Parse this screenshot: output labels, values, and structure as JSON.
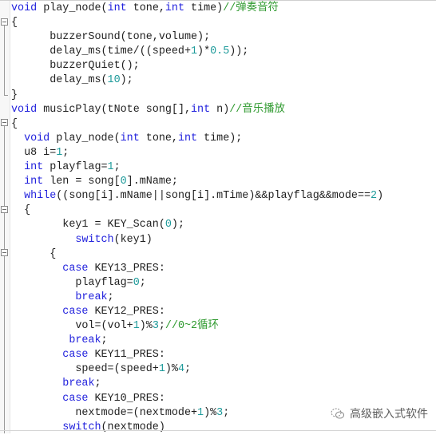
{
  "editor": {
    "lines": [
      {
        "tokens": [
          {
            "t": "void",
            "c": "kw"
          },
          {
            "t": " play_node("
          },
          {
            "t": "int",
            "c": "kw"
          },
          {
            "t": " tone,"
          },
          {
            "t": "int",
            "c": "kw"
          },
          {
            "t": " time)"
          },
          {
            "t": "//弹奏音符",
            "c": "cm"
          }
        ]
      },
      {
        "tokens": [
          {
            "t": "{"
          }
        ]
      },
      {
        "tokens": [
          {
            "t": "      buzzerSound(tone,volume);"
          }
        ]
      },
      {
        "tokens": [
          {
            "t": "      delay_ms(time/((speed+"
          },
          {
            "t": "1",
            "c": "num"
          },
          {
            "t": ")*"
          },
          {
            "t": "0.5",
            "c": "num"
          },
          {
            "t": "));"
          }
        ]
      },
      {
        "tokens": [
          {
            "t": "      buzzerQuiet();"
          }
        ]
      },
      {
        "tokens": [
          {
            "t": "      delay_ms("
          },
          {
            "t": "10",
            "c": "num"
          },
          {
            "t": ");"
          }
        ]
      },
      {
        "tokens": [
          {
            "t": "}"
          }
        ]
      },
      {
        "tokens": [
          {
            "t": "void",
            "c": "kw"
          },
          {
            "t": " musicPlay(tNote song[],"
          },
          {
            "t": "int",
            "c": "kw"
          },
          {
            "t": " n)"
          },
          {
            "t": "//音乐播放",
            "c": "cm"
          }
        ]
      },
      {
        "tokens": [
          {
            "t": "{"
          }
        ]
      },
      {
        "tokens": [
          {
            "t": "  "
          },
          {
            "t": "void",
            "c": "kw"
          },
          {
            "t": " play_node("
          },
          {
            "t": "int",
            "c": "kw"
          },
          {
            "t": " tone,"
          },
          {
            "t": "int",
            "c": "kw"
          },
          {
            "t": " time);"
          }
        ]
      },
      {
        "tokens": [
          {
            "t": "  u8 i="
          },
          {
            "t": "1",
            "c": "num"
          },
          {
            "t": ";"
          }
        ]
      },
      {
        "tokens": [
          {
            "t": "  "
          },
          {
            "t": "int",
            "c": "kw"
          },
          {
            "t": " playflag="
          },
          {
            "t": "1",
            "c": "num"
          },
          {
            "t": ";"
          }
        ]
      },
      {
        "tokens": [
          {
            "t": "  "
          },
          {
            "t": "int",
            "c": "kw"
          },
          {
            "t": " len = song["
          },
          {
            "t": "0",
            "c": "num"
          },
          {
            "t": "].mName;"
          }
        ]
      },
      {
        "tokens": [
          {
            "t": "  "
          },
          {
            "t": "while",
            "c": "kw"
          },
          {
            "t": "((song[i].mName||song[i].mTime)&&playflag&&mode=="
          },
          {
            "t": "2",
            "c": "num"
          },
          {
            "t": ")"
          }
        ]
      },
      {
        "tokens": [
          {
            "t": "  {"
          }
        ]
      },
      {
        "tokens": [
          {
            "t": "        key1 = KEY_Scan("
          },
          {
            "t": "0",
            "c": "num"
          },
          {
            "t": ");"
          }
        ]
      },
      {
        "tokens": [
          {
            "t": "          "
          },
          {
            "t": "switch",
            "c": "kw"
          },
          {
            "t": "(key1)"
          }
        ]
      },
      {
        "tokens": [
          {
            "t": "      {"
          }
        ]
      },
      {
        "tokens": [
          {
            "t": "        "
          },
          {
            "t": "case",
            "c": "kw"
          },
          {
            "t": " KEY13_PRES:"
          }
        ]
      },
      {
        "tokens": [
          {
            "t": "          playflag="
          },
          {
            "t": "0",
            "c": "num"
          },
          {
            "t": ";"
          }
        ]
      },
      {
        "tokens": [
          {
            "t": "          "
          },
          {
            "t": "break",
            "c": "kw"
          },
          {
            "t": ";"
          }
        ]
      },
      {
        "tokens": [
          {
            "t": "        "
          },
          {
            "t": "case",
            "c": "kw"
          },
          {
            "t": " KEY12_PRES:"
          }
        ]
      },
      {
        "tokens": [
          {
            "t": "          vol=(vol+"
          },
          {
            "t": "1",
            "c": "num"
          },
          {
            "t": ")%"
          },
          {
            "t": "3",
            "c": "num"
          },
          {
            "t": ";"
          },
          {
            "t": "//0~2循环",
            "c": "cm"
          }
        ]
      },
      {
        "tokens": [
          {
            "t": "         "
          },
          {
            "t": "break",
            "c": "kw"
          },
          {
            "t": ";"
          }
        ]
      },
      {
        "tokens": [
          {
            "t": "        "
          },
          {
            "t": "case",
            "c": "kw"
          },
          {
            "t": " KEY11_PRES:"
          }
        ]
      },
      {
        "tokens": [
          {
            "t": "          speed=(speed+"
          },
          {
            "t": "1",
            "c": "num"
          },
          {
            "t": ")%"
          },
          {
            "t": "4",
            "c": "num"
          },
          {
            "t": ";"
          }
        ]
      },
      {
        "tokens": [
          {
            "t": "        "
          },
          {
            "t": "break",
            "c": "kw"
          },
          {
            "t": ";"
          }
        ]
      },
      {
        "tokens": [
          {
            "t": "        "
          },
          {
            "t": "case",
            "c": "kw"
          },
          {
            "t": " KEY10_PRES:"
          }
        ]
      },
      {
        "tokens": [
          {
            "t": "          nextmode=(nextmode+"
          },
          {
            "t": "1",
            "c": "num"
          },
          {
            "t": ")%"
          },
          {
            "t": "3",
            "c": "num"
          },
          {
            "t": ";"
          }
        ]
      },
      {
        "tokens": [
          {
            "t": "        "
          },
          {
            "t": "switch",
            "c": "kw"
          },
          {
            "t": "(nextmode)"
          }
        ]
      }
    ],
    "fold_markers": [
      {
        "line": 1,
        "icon": "fold-collapse-icon"
      },
      {
        "line": 8,
        "icon": "fold-collapse-icon"
      },
      {
        "line": 14,
        "icon": "fold-collapse-icon"
      },
      {
        "line": 17,
        "icon": "fold-collapse-icon"
      }
    ]
  },
  "colors": {
    "keyword": "#2222dd",
    "number": "#1d9a9a",
    "comment": "#2f9a2f",
    "text": "#1f1f1f"
  },
  "watermark": {
    "icon": "wechat-icon",
    "text": "高级嵌入式软件"
  }
}
